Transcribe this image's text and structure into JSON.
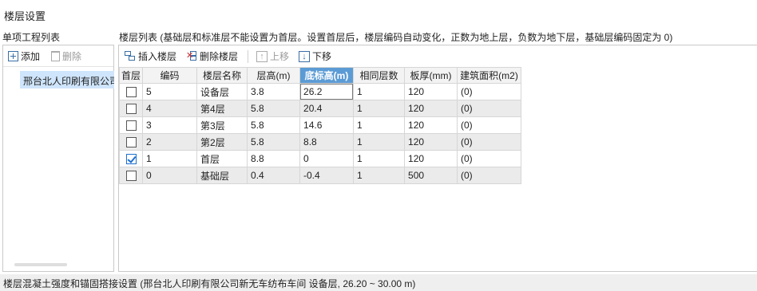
{
  "dialog": {
    "title": "楼层设置"
  },
  "left": {
    "header": "单项工程列表",
    "toolbar": {
      "add_label": "添加",
      "delete_label": "删除"
    },
    "projects": [
      "邢台北人印刷有限公司新无车纺布车间"
    ]
  },
  "right": {
    "header": "楼层列表 (基础层和标准层不能设置为首层。设置首层后，楼层编码自动变化，正数为地上层，负数为地下层，基础层编码固定为 0)",
    "toolbar": {
      "insert_label": "插入楼层",
      "delete_label": "删除楼层",
      "up_label": "上移",
      "down_label": "下移"
    },
    "columns": [
      "首层",
      "编码",
      "楼层名称",
      "层高(m)",
      "底标高(m)",
      "相同层数",
      "板厚(mm)",
      "建筑面积(m2)"
    ],
    "rows": [
      {
        "first": false,
        "code": "5",
        "name": "设备层",
        "height": "3.8",
        "bottom": "26.2",
        "same": "1",
        "slab": "120",
        "area": "(0)"
      },
      {
        "first": false,
        "code": "4",
        "name": "第4层",
        "height": "5.8",
        "bottom": "20.4",
        "same": "1",
        "slab": "120",
        "area": "(0)"
      },
      {
        "first": false,
        "code": "3",
        "name": "第3层",
        "height": "5.8",
        "bottom": "14.6",
        "same": "1",
        "slab": "120",
        "area": "(0)"
      },
      {
        "first": false,
        "code": "2",
        "name": "第2层",
        "height": "5.8",
        "bottom": "8.8",
        "same": "1",
        "slab": "120",
        "area": "(0)"
      },
      {
        "first": true,
        "code": "1",
        "name": "首层",
        "height": "8.8",
        "bottom": "0",
        "same": "1",
        "slab": "120",
        "area": "(0)"
      },
      {
        "first": false,
        "code": "0",
        "name": "基础层",
        "height": "0.4",
        "bottom": "-0.4",
        "same": "1",
        "slab": "500",
        "area": "(0)"
      }
    ]
  },
  "bottom": {
    "text": "楼层混凝土强度和锚固搭接设置 (邢台北人印刷有限公司新无车纺布车间  设备层, 26.20 ~ 30.00 m)"
  },
  "colors": {
    "selected_header": "#5b9bd5",
    "selected_item": "#cfe5fb",
    "check_blue": "#1e6fd0"
  }
}
